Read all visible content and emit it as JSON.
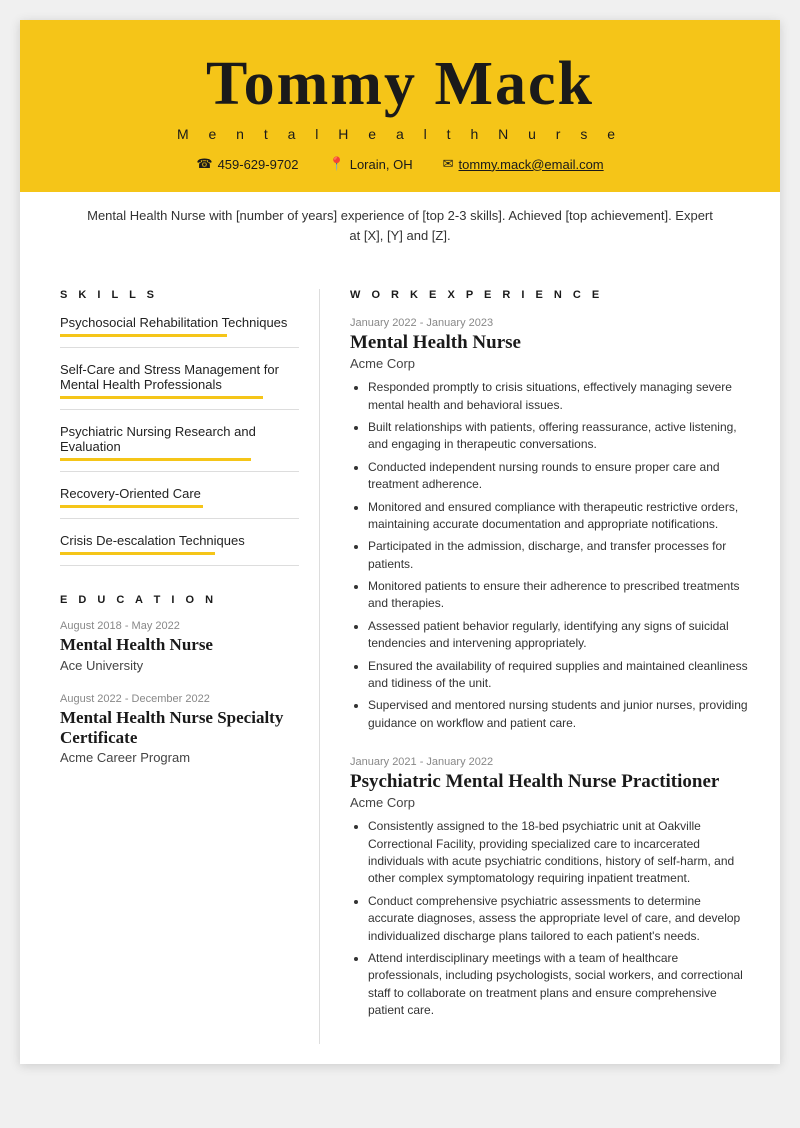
{
  "header": {
    "name": "Tommy Mack",
    "title": "M e n t a l   H e a l t h   N u r s e",
    "phone": "459-629-9702",
    "location": "Lorain, OH",
    "email": "tommy.mack@email.com",
    "summary": "Mental Health Nurse with [number of years] experience of [top 2-3 skills]. Achieved [top achievement]. Expert at [X], [Y] and [Z]."
  },
  "skills": {
    "section_title": "S K I L L S",
    "items": [
      {
        "name": "Psychosocial Rehabilitation Techniques"
      },
      {
        "name": "Self-Care and Stress Management for Mental Health Professionals"
      },
      {
        "name": "Psychiatric Nursing Research and Evaluation"
      },
      {
        "name": "Recovery-Oriented Care"
      },
      {
        "name": "Crisis De-escalation Techniques"
      }
    ]
  },
  "education": {
    "section_title": "E D U C A T I O N",
    "entries": [
      {
        "date": "August 2018 - May 2022",
        "degree": "Mental Health Nurse",
        "school": "Ace University"
      },
      {
        "date": "August 2022 - December 2022",
        "degree": "Mental Health Nurse Specialty Certificate",
        "school": "Acme Career Program"
      }
    ]
  },
  "work_experience": {
    "section_title": "W O R K   E X P E R I E N C E",
    "entries": [
      {
        "date": "January 2022 - January 2023",
        "title": "Mental Health Nurse",
        "company": "Acme Corp",
        "bullets": [
          "Responded promptly to crisis situations, effectively managing severe mental health and behavioral issues.",
          "Built relationships with patients, offering reassurance, active listening, and engaging in therapeutic conversations.",
          "Conducted independent nursing rounds to ensure proper care and treatment adherence.",
          "Monitored and ensured compliance with therapeutic restrictive orders, maintaining accurate documentation and appropriate notifications.",
          "Participated in the admission, discharge, and transfer processes for patients.",
          "Monitored patients to ensure their adherence to prescribed treatments and therapies.",
          "Assessed patient behavior regularly, identifying any signs of suicidal tendencies and intervening appropriately.",
          "Ensured the availability of required supplies and maintained cleanliness and tidiness of the unit.",
          "Supervised and mentored nursing students and junior nurses, providing guidance on workflow and patient care."
        ]
      },
      {
        "date": "January 2021 - January 2022",
        "title": "Psychiatric Mental Health Nurse Practitioner",
        "company": "Acme Corp",
        "bullets": [
          "Consistently assigned to the 18-bed psychiatric unit at Oakville Correctional Facility, providing specialized care to incarcerated individuals with acute psychiatric conditions, history of self-harm, and other complex symptomatology requiring inpatient treatment.",
          "Conduct comprehensive psychiatric assessments to determine accurate diagnoses, assess the appropriate level of care, and develop individualized discharge plans tailored to each patient's needs.",
          "Attend interdisciplinary meetings with a team of healthcare professionals, including psychologists, social workers, and correctional staff to collaborate on treatment plans and ensure comprehensive patient care."
        ]
      }
    ]
  }
}
